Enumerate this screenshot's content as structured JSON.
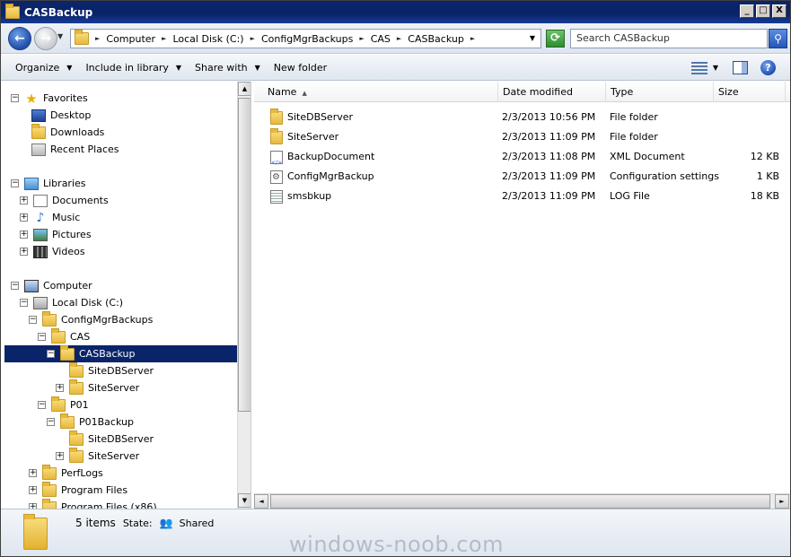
{
  "window": {
    "title": "CASBackup",
    "minimize": "_",
    "maximize": "□",
    "close": "X"
  },
  "address": {
    "breadcrumbs": [
      "Computer",
      "Local Disk (C:)",
      "ConfigMgrBackups",
      "CAS",
      "CASBackup"
    ],
    "search_placeholder": "Search CASBackup"
  },
  "toolbar": {
    "organize": "Organize",
    "include_in_library": "Include in library",
    "share_with": "Share with",
    "new_folder": "New folder"
  },
  "tree": {
    "favorites": "Favorites",
    "desktop": "Desktop",
    "downloads": "Downloads",
    "recent_places": "Recent Places",
    "libraries": "Libraries",
    "documents": "Documents",
    "music": "Music",
    "pictures": "Pictures",
    "videos": "Videos",
    "computer": "Computer",
    "local_disk": "Local Disk (C:)",
    "configmgrbackups": "ConfigMgrBackups",
    "cas": "CAS",
    "casbackup": "CASBackup",
    "sitedbserver_1": "SiteDBServer",
    "siteserver_1": "SiteServer",
    "p01": "P01",
    "p01backup": "P01Backup",
    "sitedbserver_2": "SiteDBServer",
    "siteserver_2": "SiteServer",
    "perflogs": "PerfLogs",
    "program_files": "Program Files",
    "program_files_x86": "Program Files (x86)"
  },
  "columns": {
    "name": "Name",
    "date_modified": "Date modified",
    "type": "Type",
    "size": "Size"
  },
  "files": [
    {
      "name": "SiteDBServer",
      "date": "2/3/2013 10:56 PM",
      "type": "File folder",
      "size": ""
    },
    {
      "name": "SiteServer",
      "date": "2/3/2013 11:09 PM",
      "type": "File folder",
      "size": ""
    },
    {
      "name": "BackupDocument",
      "date": "2/3/2013 11:08 PM",
      "type": "XML Document",
      "size": "12 KB"
    },
    {
      "name": "ConfigMgrBackup",
      "date": "2/3/2013 11:09 PM",
      "type": "Configuration settings",
      "size": "1 KB"
    },
    {
      "name": "smsbkup",
      "date": "2/3/2013 11:09 PM",
      "type": "LOG File",
      "size": "18 KB"
    }
  ],
  "details": {
    "item_count": "5 items",
    "state_label": "State:",
    "state_value": "Shared"
  },
  "watermark": "windows-noob.com"
}
